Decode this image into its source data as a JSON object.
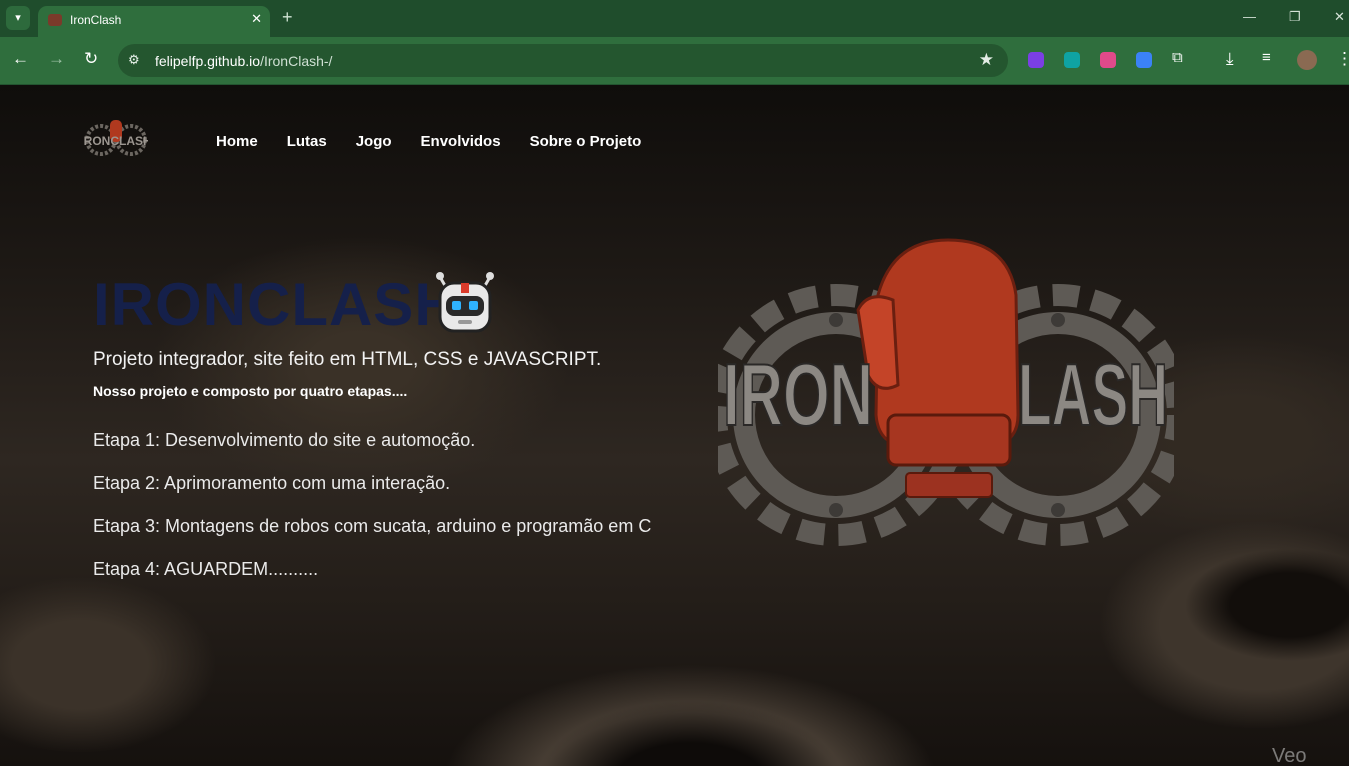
{
  "browser": {
    "tab_title": "IronClash",
    "url_host": "felipelfp.github.io",
    "url_path": "/IronClash-/"
  },
  "nav": {
    "items": [
      "Home",
      "Lutas",
      "Jogo",
      "Envolvidos",
      "Sobre o Projeto"
    ]
  },
  "hero": {
    "title": "IRONCLASH",
    "subtitle": "Projeto integrador, site feito em HTML, CSS e JAVASCRIPT.",
    "lead": "Nosso projeto e composto por quatro etapas....",
    "steps": [
      "Etapa 1: Desenvolvimento do site e automoção.",
      "Etapa 2: Aprimoramento com uma interação.",
      "Etapa 3: Montagens de robos com sucata, arduino e programão em C",
      "Etapa 4: AGUARDEM.........."
    ]
  },
  "logo": {
    "text_left": "IRON",
    "text_right": "LASH",
    "small_text": "IRONCLASH"
  },
  "watermark": "Veo",
  "colors": {
    "title": "#15204a",
    "tabbar": "#1f4d2c",
    "toolbar": "#2f6e3d"
  }
}
